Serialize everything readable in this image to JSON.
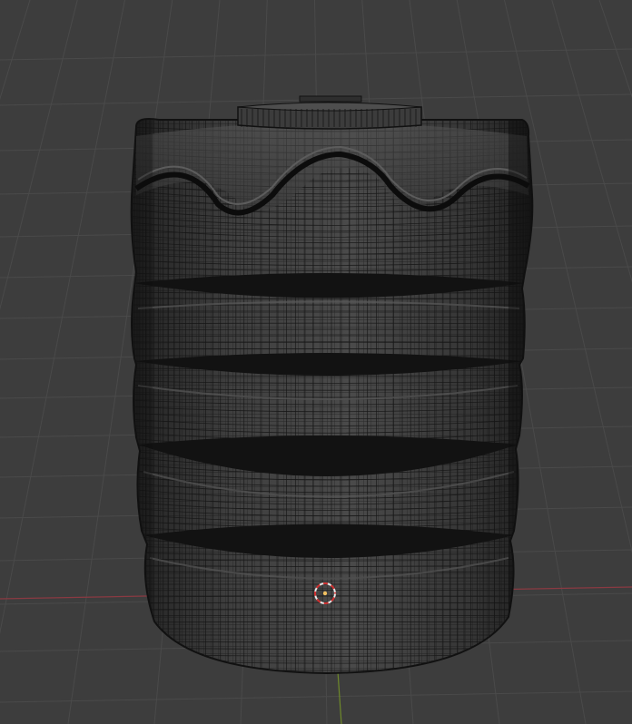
{
  "viewport": {
    "background_color": "#3d3d3d",
    "grid_color": "#4a4a4a",
    "x_axis_color": "#8a3a42",
    "y_axis_color": "#6f8a2a",
    "mesh_fill_color": "#3a3a3a",
    "wire_color": "#161616",
    "origin_marker_outer_color": "#e8e8e8",
    "origin_marker_inner_color": "#d03030",
    "origin_dot_color": "#f0c060"
  },
  "object": {
    "type": "mesh",
    "description_icon": "water-tank-mesh-icon"
  }
}
